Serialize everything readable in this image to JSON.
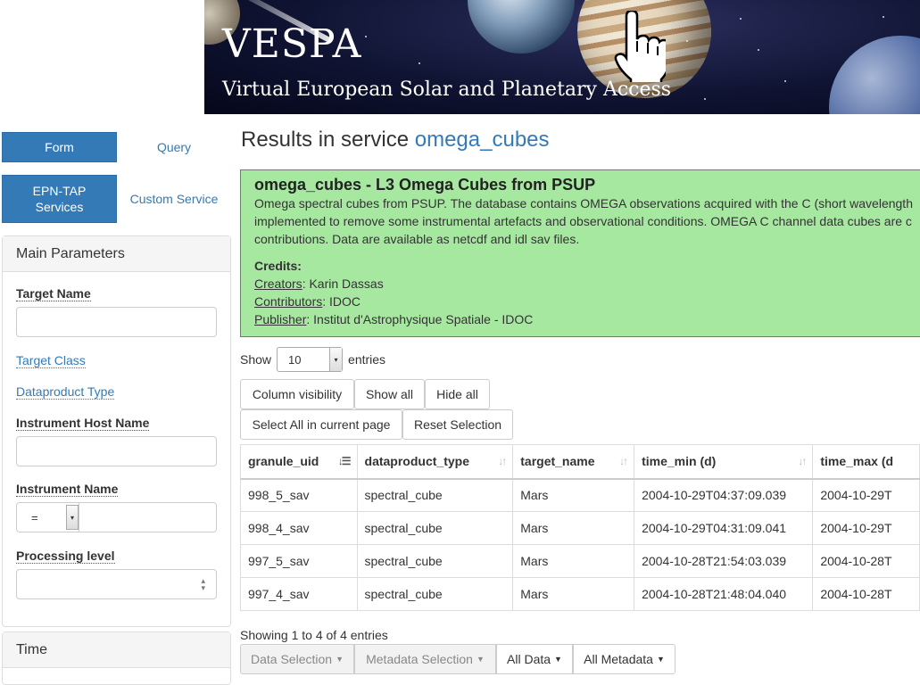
{
  "banner": {
    "title": "VESPA",
    "subtitle": "Virtual European Solar and Planetary Access"
  },
  "sidebar": {
    "nav": [
      {
        "label": "Form",
        "active": true
      },
      {
        "label": "Query",
        "active": false
      },
      {
        "label": "EPN-TAP Services",
        "active": true
      },
      {
        "label": "Custom Service",
        "active": false
      }
    ],
    "main_parameters": {
      "heading": "Main Parameters",
      "target_name_label": "Target Name",
      "target_class_link": "Target Class",
      "dataproduct_type_link": "Dataproduct Type",
      "instrument_host_label": "Instrument Host Name",
      "instrument_name_label": "Instrument Name",
      "instrument_operator": "=",
      "processing_level_label": "Processing level"
    },
    "time_heading": "Time"
  },
  "main": {
    "results_prefix": "Results in service",
    "service_name": "omega_cubes",
    "service_box": {
      "title": "omega_cubes - L3 Omega Cubes from PSUP",
      "description_lines": [
        "Omega spectral cubes from PSUP. The database contains OMEGA observations acquired with the C (short wavelength",
        "implemented to remove some instrumental artefacts and observational conditions. OMEGA C channel data cubes are c",
        "contributions. Data are available as netcdf and idl sav files."
      ],
      "credits_heading": "Credits:",
      "credits": [
        {
          "role": "Creators",
          "value": ": Karin Dassas"
        },
        {
          "role": "Contributors",
          "value": ": IDOC"
        },
        {
          "role": "Publisher",
          "value": ": Institut d'Astrophysique Spatiale - IDOC"
        }
      ]
    },
    "show_label": "Show",
    "entries_value": "10",
    "entries_label": "entries",
    "buttons": {
      "column_visibility": "Column visibility",
      "show_all": "Show all",
      "hide_all": "Hide all",
      "select_all_page": "Select All in current page",
      "reset_selection": "Reset Selection"
    },
    "table": {
      "columns": [
        "granule_uid",
        "dataproduct_type",
        "target_name",
        "time_min (d)",
        "time_max (d"
      ],
      "rows": [
        [
          "998_5_sav",
          "spectral_cube",
          "Mars",
          "2004-10-29T04:37:09.039",
          "2004-10-29T"
        ],
        [
          "998_4_sav",
          "spectral_cube",
          "Mars",
          "2004-10-29T04:31:09.041",
          "2004-10-29T"
        ],
        [
          "997_5_sav",
          "spectral_cube",
          "Mars",
          "2004-10-28T21:54:03.039",
          "2004-10-28T"
        ],
        [
          "997_4_sav",
          "spectral_cube",
          "Mars",
          "2004-10-28T21:48:04.040",
          "2004-10-28T"
        ]
      ]
    },
    "showing_text": "Showing 1 to 4 of 4 entries",
    "bottom_buttons": [
      {
        "label": "Data Selection",
        "disabled": true
      },
      {
        "label": "Metadata Selection",
        "disabled": true
      },
      {
        "label": "All Data",
        "disabled": false
      },
      {
        "label": "All Metadata",
        "disabled": false
      }
    ]
  }
}
